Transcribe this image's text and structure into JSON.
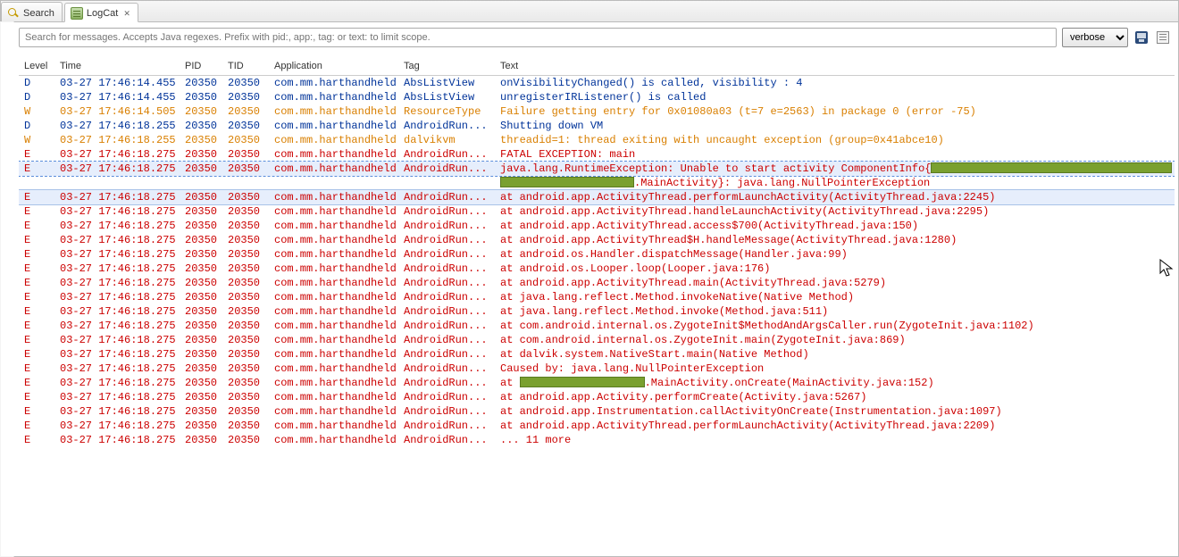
{
  "tabs": {
    "search": "Search",
    "logcat": "LogCat"
  },
  "toolbar": {
    "search_placeholder": "Search for messages. Accepts Java regexes. Prefix with pid:, app:, tag: or text: to limit scope.",
    "level_selected": "verbose"
  },
  "columns": {
    "level": "Level",
    "time": "Time",
    "pid": "PID",
    "tid": "TID",
    "app": "Application",
    "tag": "Tag",
    "text": "Text"
  },
  "redaction": {
    "package_label": ".MainActivity}: java.lang.NullPointerException",
    "oncreate_suffix": ".MainActivity.onCreate(MainActivity.java:152)"
  },
  "rows": [
    {
      "level": "D",
      "time": "03-27 17:46:14.455",
      "pid": "20350",
      "tid": "20350",
      "app": "com.mm.harthandheld",
      "tag": "AbsListView",
      "text": "onVisibilityChanged() is called, visibility : 4"
    },
    {
      "level": "D",
      "time": "03-27 17:46:14.455",
      "pid": "20350",
      "tid": "20350",
      "app": "com.mm.harthandheld",
      "tag": "AbsListView",
      "text": "unregisterIRListener() is called"
    },
    {
      "level": "W",
      "time": "03-27 17:46:14.505",
      "pid": "20350",
      "tid": "20350",
      "app": "com.mm.harthandheld",
      "tag": "ResourceType",
      "text": "Failure getting entry for 0x01080a03 (t=7 e=2563) in package 0 (error -75)"
    },
    {
      "level": "D",
      "time": "03-27 17:46:18.255",
      "pid": "20350",
      "tid": "20350",
      "app": "com.mm.harthandheld",
      "tag": "AndroidRun...",
      "text": "Shutting down VM"
    },
    {
      "level": "W",
      "time": "03-27 17:46:18.255",
      "pid": "20350",
      "tid": "20350",
      "app": "com.mm.harthandheld",
      "tag": "dalvikvm",
      "text": "threadid=1: thread exiting with uncaught exception (group=0x41abce10)"
    },
    {
      "level": "E",
      "time": "03-27 17:46:18.275",
      "pid": "20350",
      "tid": "20350",
      "app": "com.mm.harthandheld",
      "tag": "AndroidRun...",
      "text": "FATAL EXCEPTION: main"
    },
    {
      "level": "E",
      "time": "03-27 17:46:18.275",
      "pid": "20350",
      "tid": "20350",
      "app": "com.mm.harthandheld",
      "tag": "AndroidRun...",
      "text": "java.lang.RuntimeException: Unable to start activity ComponentInfo{",
      "special": "redact1",
      "hl": true,
      "sel": true
    },
    {
      "level": "",
      "time": "",
      "pid": "",
      "tid": "",
      "app": "",
      "tag": "",
      "text": "",
      "special": "redact2"
    },
    {
      "level": "E",
      "time": "03-27 17:46:18.275",
      "pid": "20350",
      "tid": "20350",
      "app": "com.mm.harthandheld",
      "tag": "AndroidRun...",
      "text": "at android.app.ActivityThread.performLaunchActivity(ActivityThread.java:2245)",
      "hl": true
    },
    {
      "level": "E",
      "time": "03-27 17:46:18.275",
      "pid": "20350",
      "tid": "20350",
      "app": "com.mm.harthandheld",
      "tag": "AndroidRun...",
      "text": "at android.app.ActivityThread.handleLaunchActivity(ActivityThread.java:2295)"
    },
    {
      "level": "E",
      "time": "03-27 17:46:18.275",
      "pid": "20350",
      "tid": "20350",
      "app": "com.mm.harthandheld",
      "tag": "AndroidRun...",
      "text": "at android.app.ActivityThread.access$700(ActivityThread.java:150)"
    },
    {
      "level": "E",
      "time": "03-27 17:46:18.275",
      "pid": "20350",
      "tid": "20350",
      "app": "com.mm.harthandheld",
      "tag": "AndroidRun...",
      "text": "at android.app.ActivityThread$H.handleMessage(ActivityThread.java:1280)"
    },
    {
      "level": "E",
      "time": "03-27 17:46:18.275",
      "pid": "20350",
      "tid": "20350",
      "app": "com.mm.harthandheld",
      "tag": "AndroidRun...",
      "text": "at android.os.Handler.dispatchMessage(Handler.java:99)"
    },
    {
      "level": "E",
      "time": "03-27 17:46:18.275",
      "pid": "20350",
      "tid": "20350",
      "app": "com.mm.harthandheld",
      "tag": "AndroidRun...",
      "text": "at android.os.Looper.loop(Looper.java:176)"
    },
    {
      "level": "E",
      "time": "03-27 17:46:18.275",
      "pid": "20350",
      "tid": "20350",
      "app": "com.mm.harthandheld",
      "tag": "AndroidRun...",
      "text": "at android.app.ActivityThread.main(ActivityThread.java:5279)"
    },
    {
      "level": "E",
      "time": "03-27 17:46:18.275",
      "pid": "20350",
      "tid": "20350",
      "app": "com.mm.harthandheld",
      "tag": "AndroidRun...",
      "text": "at java.lang.reflect.Method.invokeNative(Native Method)"
    },
    {
      "level": "E",
      "time": "03-27 17:46:18.275",
      "pid": "20350",
      "tid": "20350",
      "app": "com.mm.harthandheld",
      "tag": "AndroidRun...",
      "text": "at java.lang.reflect.Method.invoke(Method.java:511)"
    },
    {
      "level": "E",
      "time": "03-27 17:46:18.275",
      "pid": "20350",
      "tid": "20350",
      "app": "com.mm.harthandheld",
      "tag": "AndroidRun...",
      "text": "at com.android.internal.os.ZygoteInit$MethodAndArgsCaller.run(ZygoteInit.java:1102)"
    },
    {
      "level": "E",
      "time": "03-27 17:46:18.275",
      "pid": "20350",
      "tid": "20350",
      "app": "com.mm.harthandheld",
      "tag": "AndroidRun...",
      "text": "at com.android.internal.os.ZygoteInit.main(ZygoteInit.java:869)"
    },
    {
      "level": "E",
      "time": "03-27 17:46:18.275",
      "pid": "20350",
      "tid": "20350",
      "app": "com.mm.harthandheld",
      "tag": "AndroidRun...",
      "text": "at dalvik.system.NativeStart.main(Native Method)"
    },
    {
      "level": "E",
      "time": "03-27 17:46:18.275",
      "pid": "20350",
      "tid": "20350",
      "app": "com.mm.harthandheld",
      "tag": "AndroidRun...",
      "text": "Caused by: java.lang.NullPointerException"
    },
    {
      "level": "E",
      "time": "03-27 17:46:18.275",
      "pid": "20350",
      "tid": "20350",
      "app": "com.mm.harthandheld",
      "tag": "AndroidRun...",
      "text": "at ",
      "special": "redact3"
    },
    {
      "level": "E",
      "time": "03-27 17:46:18.275",
      "pid": "20350",
      "tid": "20350",
      "app": "com.mm.harthandheld",
      "tag": "AndroidRun...",
      "text": "at android.app.Activity.performCreate(Activity.java:5267)"
    },
    {
      "level": "E",
      "time": "03-27 17:46:18.275",
      "pid": "20350",
      "tid": "20350",
      "app": "com.mm.harthandheld",
      "tag": "AndroidRun...",
      "text": "at android.app.Instrumentation.callActivityOnCreate(Instrumentation.java:1097)"
    },
    {
      "level": "E",
      "time": "03-27 17:46:18.275",
      "pid": "20350",
      "tid": "20350",
      "app": "com.mm.harthandheld",
      "tag": "AndroidRun...",
      "text": "at android.app.ActivityThread.performLaunchActivity(ActivityThread.java:2209)"
    },
    {
      "level": "E",
      "time": "03-27 17:46:18.275",
      "pid": "20350",
      "tid": "20350",
      "app": "com.mm.harthandheld",
      "tag": "AndroidRun...",
      "text": "... 11 more"
    }
  ]
}
